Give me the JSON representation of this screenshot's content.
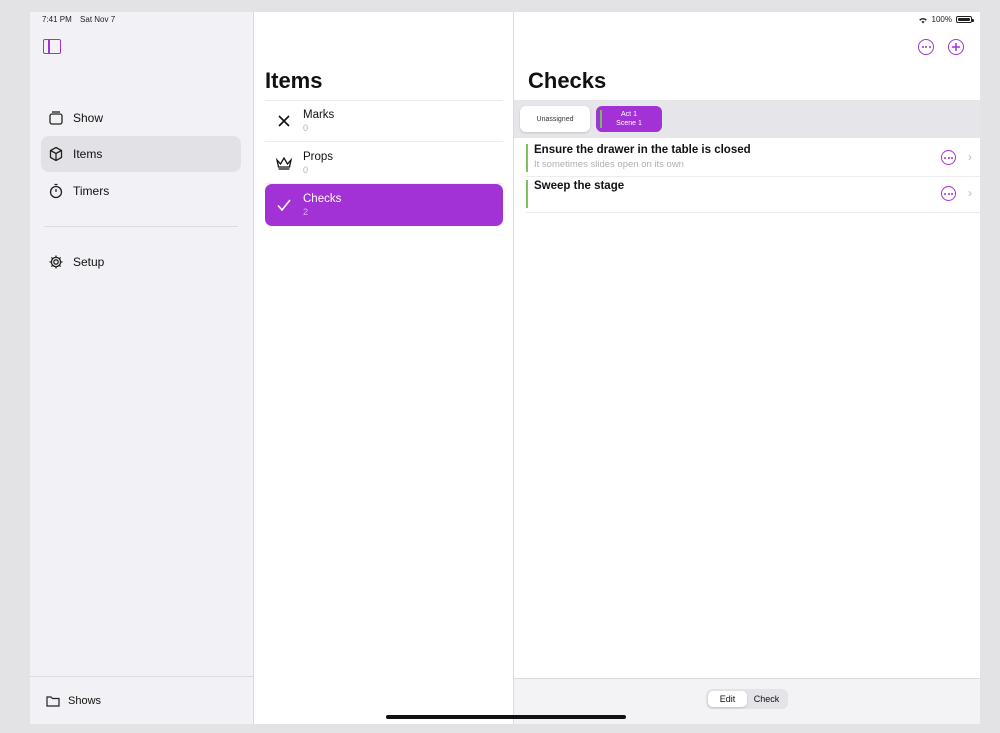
{
  "status_bar": {
    "time": "7:41 PM",
    "date": "Sat Nov 7",
    "battery": "100%"
  },
  "sidebar": {
    "items": [
      {
        "label": "Show",
        "icon": "show-icon"
      },
      {
        "label": "Items",
        "icon": "cube-icon",
        "selected": true
      },
      {
        "label": "Timers",
        "icon": "stopwatch-icon"
      },
      {
        "label": "Setup",
        "icon": "gear-icon"
      }
    ],
    "footer_label": "Shows"
  },
  "items_column": {
    "title": "Items",
    "rows": [
      {
        "name": "Marks",
        "count": "0",
        "icon": "x-icon"
      },
      {
        "name": "Props",
        "count": "0",
        "icon": "crown-icon"
      },
      {
        "name": "Checks",
        "count": "2",
        "icon": "checkmark-icon",
        "selected": true
      }
    ]
  },
  "detail": {
    "title": "Checks",
    "filters": {
      "unassigned": "Unassigned",
      "act": "Act 1",
      "scene": "Scene 1"
    },
    "checks": [
      {
        "title": "Ensure the drawer in the table is closed",
        "subtitle": "It sometimes slides open on its own"
      },
      {
        "title": "Sweep the stage",
        "subtitle": ""
      }
    ],
    "mode": {
      "edit": "Edit",
      "check": "Check",
      "selected": "Edit"
    }
  },
  "colors": {
    "accent": "#a232d6",
    "scene_bar": "#7cc35a"
  }
}
